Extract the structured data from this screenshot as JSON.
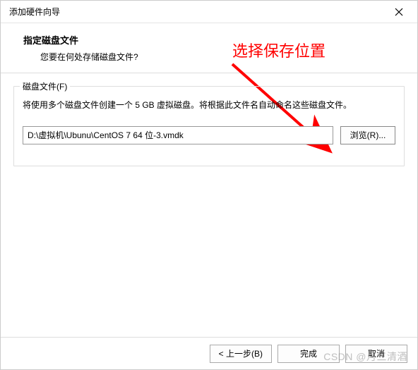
{
  "window": {
    "title": "添加硬件向导"
  },
  "header": {
    "title": "指定磁盘文件",
    "subtitle": "您要在何处存储磁盘文件?"
  },
  "annotation": {
    "text": "选择保存位置"
  },
  "group": {
    "legend": "磁盘文件(F)",
    "description": "将使用多个磁盘文件创建一个 5 GB 虚拟磁盘。将根据此文件名自动命名这些磁盘文件。",
    "path_value": "D:\\虚拟机\\Ubunu\\CentOS 7 64 位-3.vmdk",
    "browse_label": "浏览(R)..."
  },
  "footer": {
    "back_label": "< 上一步(B)",
    "finish_label": "完成",
    "cancel_label": "取消"
  },
  "watermark": "CSDN @月三清酒"
}
